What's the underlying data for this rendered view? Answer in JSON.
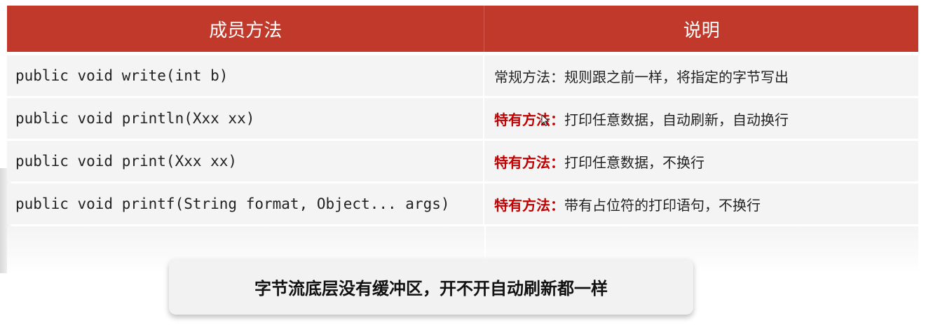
{
  "table": {
    "headers": [
      "成员方法",
      "说明"
    ],
    "rows": [
      {
        "method": "public void write(int b)",
        "highlight": "",
        "description": "常规方法：规则跟之前一样，将指定的字节写出"
      },
      {
        "method": "public void println(Xxx xx)",
        "highlight": "特有方法：",
        "description": "打印任意数据，自动刷新，自动换行"
      },
      {
        "method": "public void print(Xxx xx)",
        "highlight": "特有方法：",
        "description": "打印任意数据，不换行"
      },
      {
        "method": "public void printf(String format, Object... args)",
        "highlight": "特有方法：",
        "description": "带有占位符的打印语句，不换行"
      }
    ]
  },
  "note": "字节流底层没有缓冲区，开不开自动刷新都一样",
  "colors": {
    "header_bg": "#c0392b",
    "highlight_text": "#c00000",
    "row_bg": "#f4f4f4"
  },
  "cursor": {
    "icon": "mouse-pointer-icon"
  }
}
